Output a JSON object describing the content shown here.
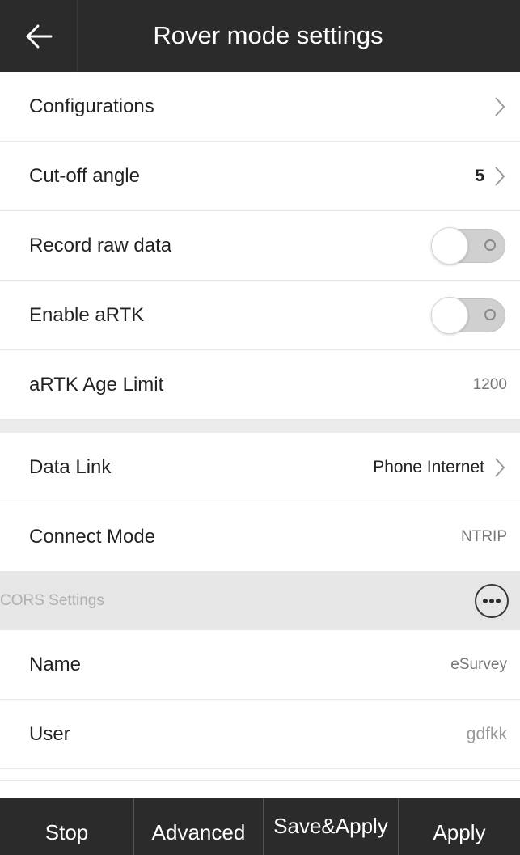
{
  "header": {
    "title": "Rover mode settings",
    "back_icon": "arrow-left-icon"
  },
  "rows": {
    "configurations": {
      "label": "Configurations"
    },
    "cutoff_angle": {
      "label": "Cut-off angle",
      "value": "5"
    },
    "record_raw_data": {
      "label": "Record raw data",
      "enabled": false
    },
    "enable_artk": {
      "label": "Enable aRTK",
      "enabled": false
    },
    "artk_age_limit": {
      "label": "aRTK Age Limit",
      "value": "1200"
    },
    "data_link": {
      "label": "Data Link",
      "value": "Phone Internet"
    },
    "connect_mode": {
      "label": "Connect Mode",
      "value": "NTRIP"
    }
  },
  "cors_section": {
    "title": "CORS Settings",
    "more_icon": "more-horizontal-icon",
    "rows": {
      "name": {
        "label": "Name",
        "value": "eSurvey"
      },
      "user": {
        "label": "User",
        "value": "gdfkk"
      }
    }
  },
  "bottom_bar": {
    "stop": "Stop",
    "advanced": "Advanced",
    "save_apply": "Save&Apply",
    "apply": "Apply"
  },
  "colors": {
    "header_bg": "#2b2b2b",
    "section_bg": "#e6e6e6",
    "text_primary": "#222222",
    "text_muted": "#777777"
  }
}
